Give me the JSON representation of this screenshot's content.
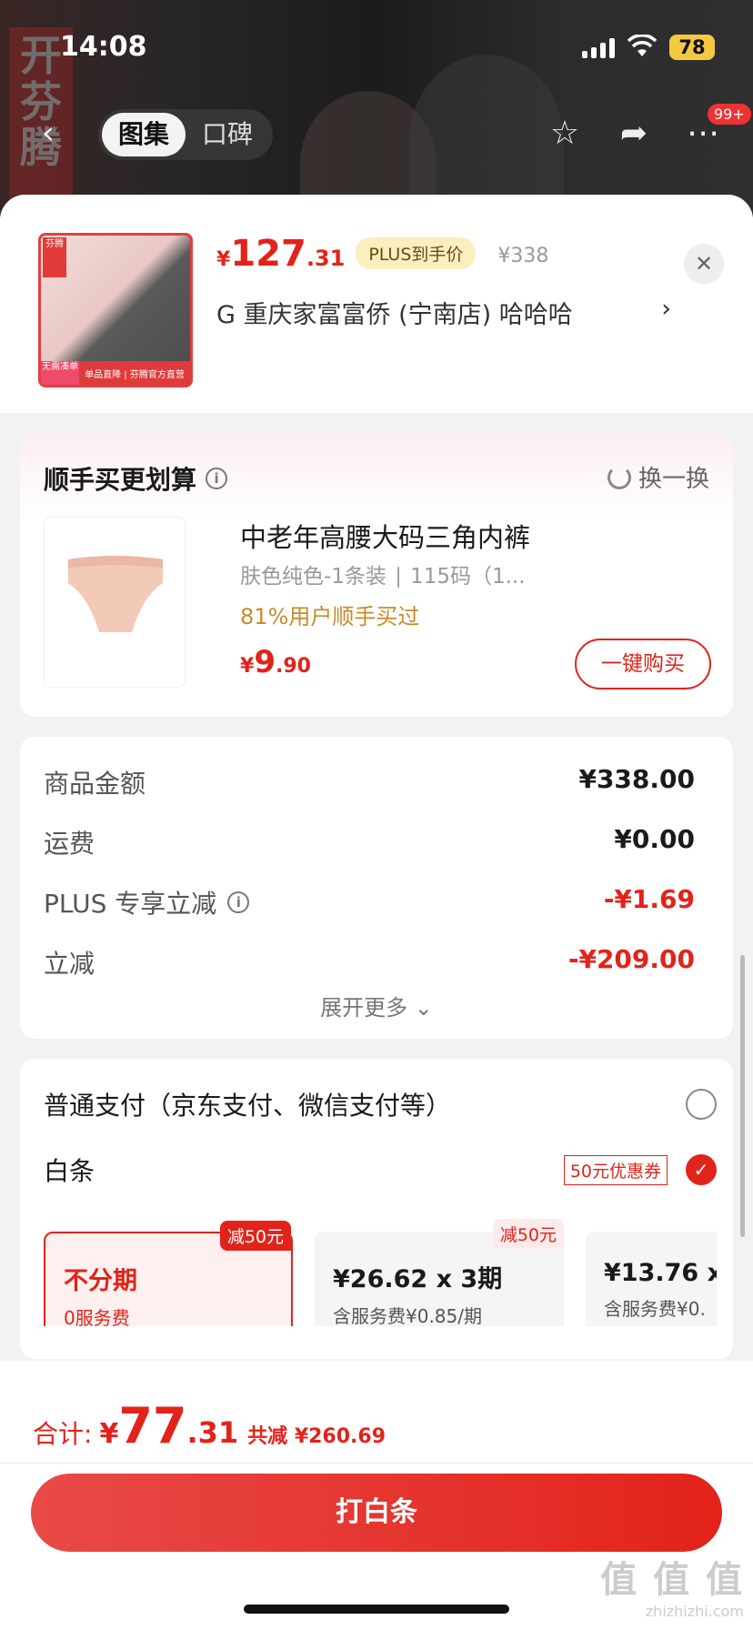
{
  "status": {
    "time": "14:08",
    "battery": "78"
  },
  "nav": {
    "tabs": [
      "图集",
      "口碑"
    ],
    "badge": "99+",
    "brand_vertical": "开\n芬\n腾"
  },
  "product": {
    "price_yen": "¥",
    "price_int": "127",
    "price_dec": ".31",
    "plus_tag": "PLUS到手价",
    "original_price": "¥338",
    "store": "G 重庆家富富侨 (宁南店) 哈哈哈",
    "thumb_brand": "芬腾",
    "thumb_foot_a": "无需凑单",
    "thumb_foot_b": "单品直降 | 芬腾官方直营"
  },
  "addon": {
    "title": "顺手买更划算",
    "refresh": "换一换",
    "name": "中老年高腰大码三角内裤",
    "spec": "肤色纯色-1条装 ∣ 115码（1...",
    "pct": "81%用户顺手买过",
    "price_yen": "¥",
    "price_int": "9",
    "price_dec": ".90",
    "buy_label": "一键购买"
  },
  "summary": {
    "rows": [
      {
        "label": "商品金额",
        "value": "¥338.00"
      },
      {
        "label": "运费",
        "value": "¥0.00"
      },
      {
        "label": "PLUS 专享立减",
        "value": "-¥1.69"
      },
      {
        "label": "立减",
        "value": "-¥209.00"
      }
    ],
    "expand": "展开更多 ⌄"
  },
  "payment": {
    "normal": "普通支付（京东支付、微信支付等）",
    "baitiao": "白条",
    "coupon": "50元优惠券",
    "installments": [
      {
        "title": "不分期",
        "sub": "0服务费",
        "tag": "减50元"
      },
      {
        "title": "¥26.62 x 3期",
        "sub": "含服务费¥0.85/期",
        "tag": "减50元"
      },
      {
        "title": "¥13.76 x",
        "sub": "含服务费¥0."
      }
    ]
  },
  "bottom": {
    "total_label": "合计:",
    "total_yen": "¥",
    "total_int": "77",
    "total_dec": ".31",
    "total_save": "共减 ¥260.69",
    "pay_button": "打白条"
  },
  "watermark": {
    "big": "值 值 值",
    "small": "zhizhizhi.com"
  },
  "colors": {
    "accent": "#e2231a",
    "plus_tag_bg": "#fbefc0",
    "highlight": "#c98a2a"
  }
}
